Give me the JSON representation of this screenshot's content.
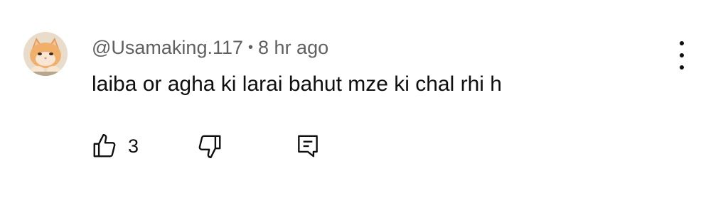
{
  "comment": {
    "author": "@Usamaking.117",
    "separator": "•",
    "time": "8 hr ago",
    "text": "laiba or agha ki larai bahut mze ki chal rhi h",
    "avatar_icon": "kitten-avatar"
  },
  "actions": {
    "like_icon": "thumb-up-icon",
    "like_count": "3",
    "dislike_icon": "thumb-down-icon",
    "reply_icon": "reply-comment-icon"
  },
  "menu": {
    "icon": "more-vertical-icon"
  },
  "colors": {
    "text": "#0f0f0f",
    "meta": "#606060",
    "background": "#ffffff"
  }
}
